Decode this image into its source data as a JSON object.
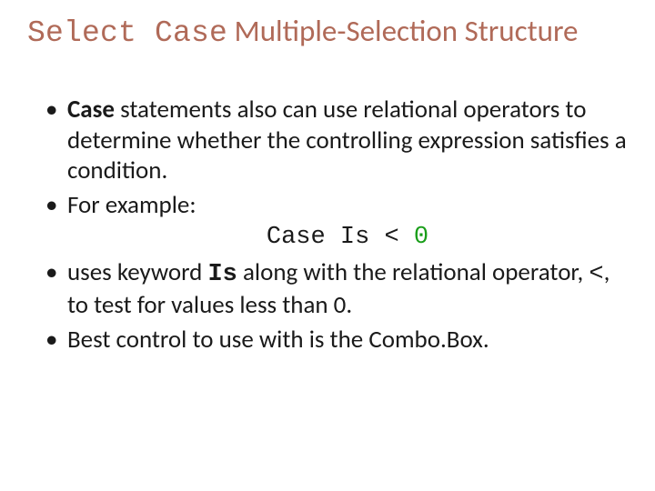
{
  "title": {
    "code": "Select Case",
    "rest": " Multiple-Selection Structure"
  },
  "bullets": {
    "b1_kw": "Case",
    "b1_rest": " statements also can use relational operators to determine whether the controlling expression satisfies a condition.",
    "b2": "For example:",
    "code_prefix": "Case Is < ",
    "code_zero": "0",
    "b3_a": "uses keyword ",
    "b3_kw": "Is",
    "b3_b": " along with the relational operator, ",
    "b3_op": "<",
    "b3_c": ", to test for values less than 0.",
    "b4": "Best control to use with is the Combo.Box."
  }
}
